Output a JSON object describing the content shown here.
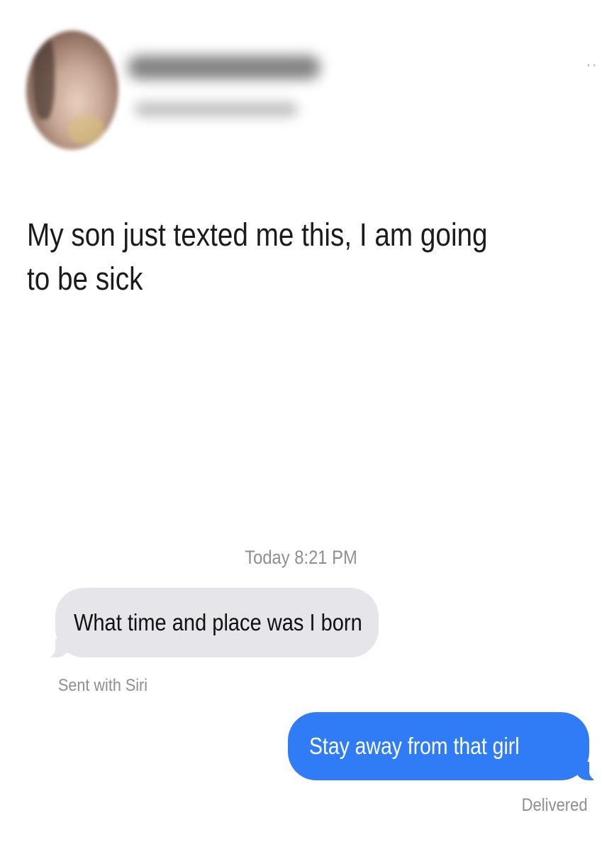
{
  "post": {
    "text": "My son just texted me this, I am going to be sick"
  },
  "conversation": {
    "timestamp": "Today 8:21 PM",
    "messages": [
      {
        "direction": "incoming",
        "text": "What time and place was I born",
        "footnote": "Sent with Siri"
      },
      {
        "direction": "outgoing",
        "text": "Stay away from that girl",
        "status": "Delivered"
      }
    ]
  },
  "icons": {
    "avatar": "profile-photo-blurred",
    "more": "more-options-icon"
  },
  "colors": {
    "incoming_bubble": "#e5e5ea",
    "outgoing_bubble": "#2f7cf6",
    "meta_text": "#8e8e93"
  }
}
